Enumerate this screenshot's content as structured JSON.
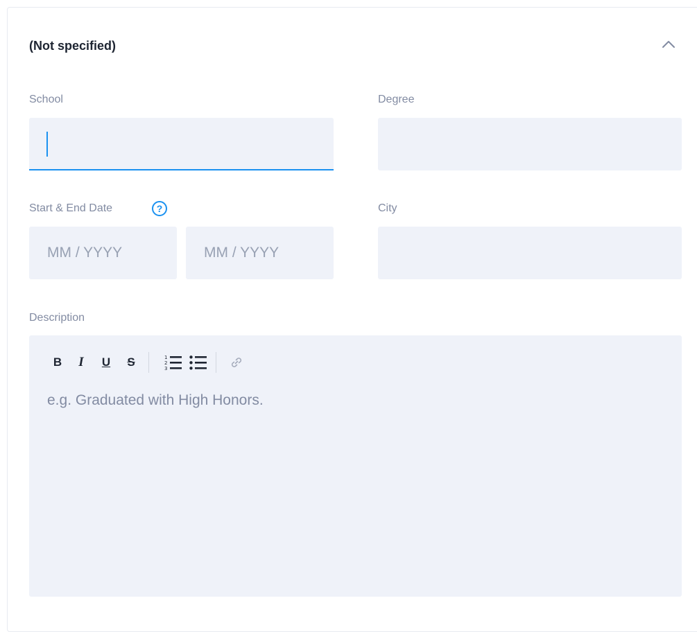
{
  "section": {
    "title": "(Not specified)"
  },
  "fields": {
    "school": {
      "label": "School",
      "value": ""
    },
    "degree": {
      "label": "Degree",
      "value": ""
    },
    "dates": {
      "label": "Start & End Date",
      "help_glyph": "?",
      "start_placeholder": "MM / YYYY",
      "end_placeholder": "MM / YYYY"
    },
    "city": {
      "label": "City",
      "value": ""
    },
    "description": {
      "label": "Description",
      "placeholder": "e.g. Graduated with High Honors."
    }
  },
  "toolbar": {
    "bold": "B",
    "italic": "I",
    "underline": "U",
    "strike": "S",
    "icons": [
      "ordered-list-icon",
      "bullet-list-icon",
      "link-icon"
    ]
  },
  "colors": {
    "accent": "#1a91f0",
    "field_bg": "#eff2f9",
    "label": "#828ba2",
    "text": "#1e2532"
  }
}
